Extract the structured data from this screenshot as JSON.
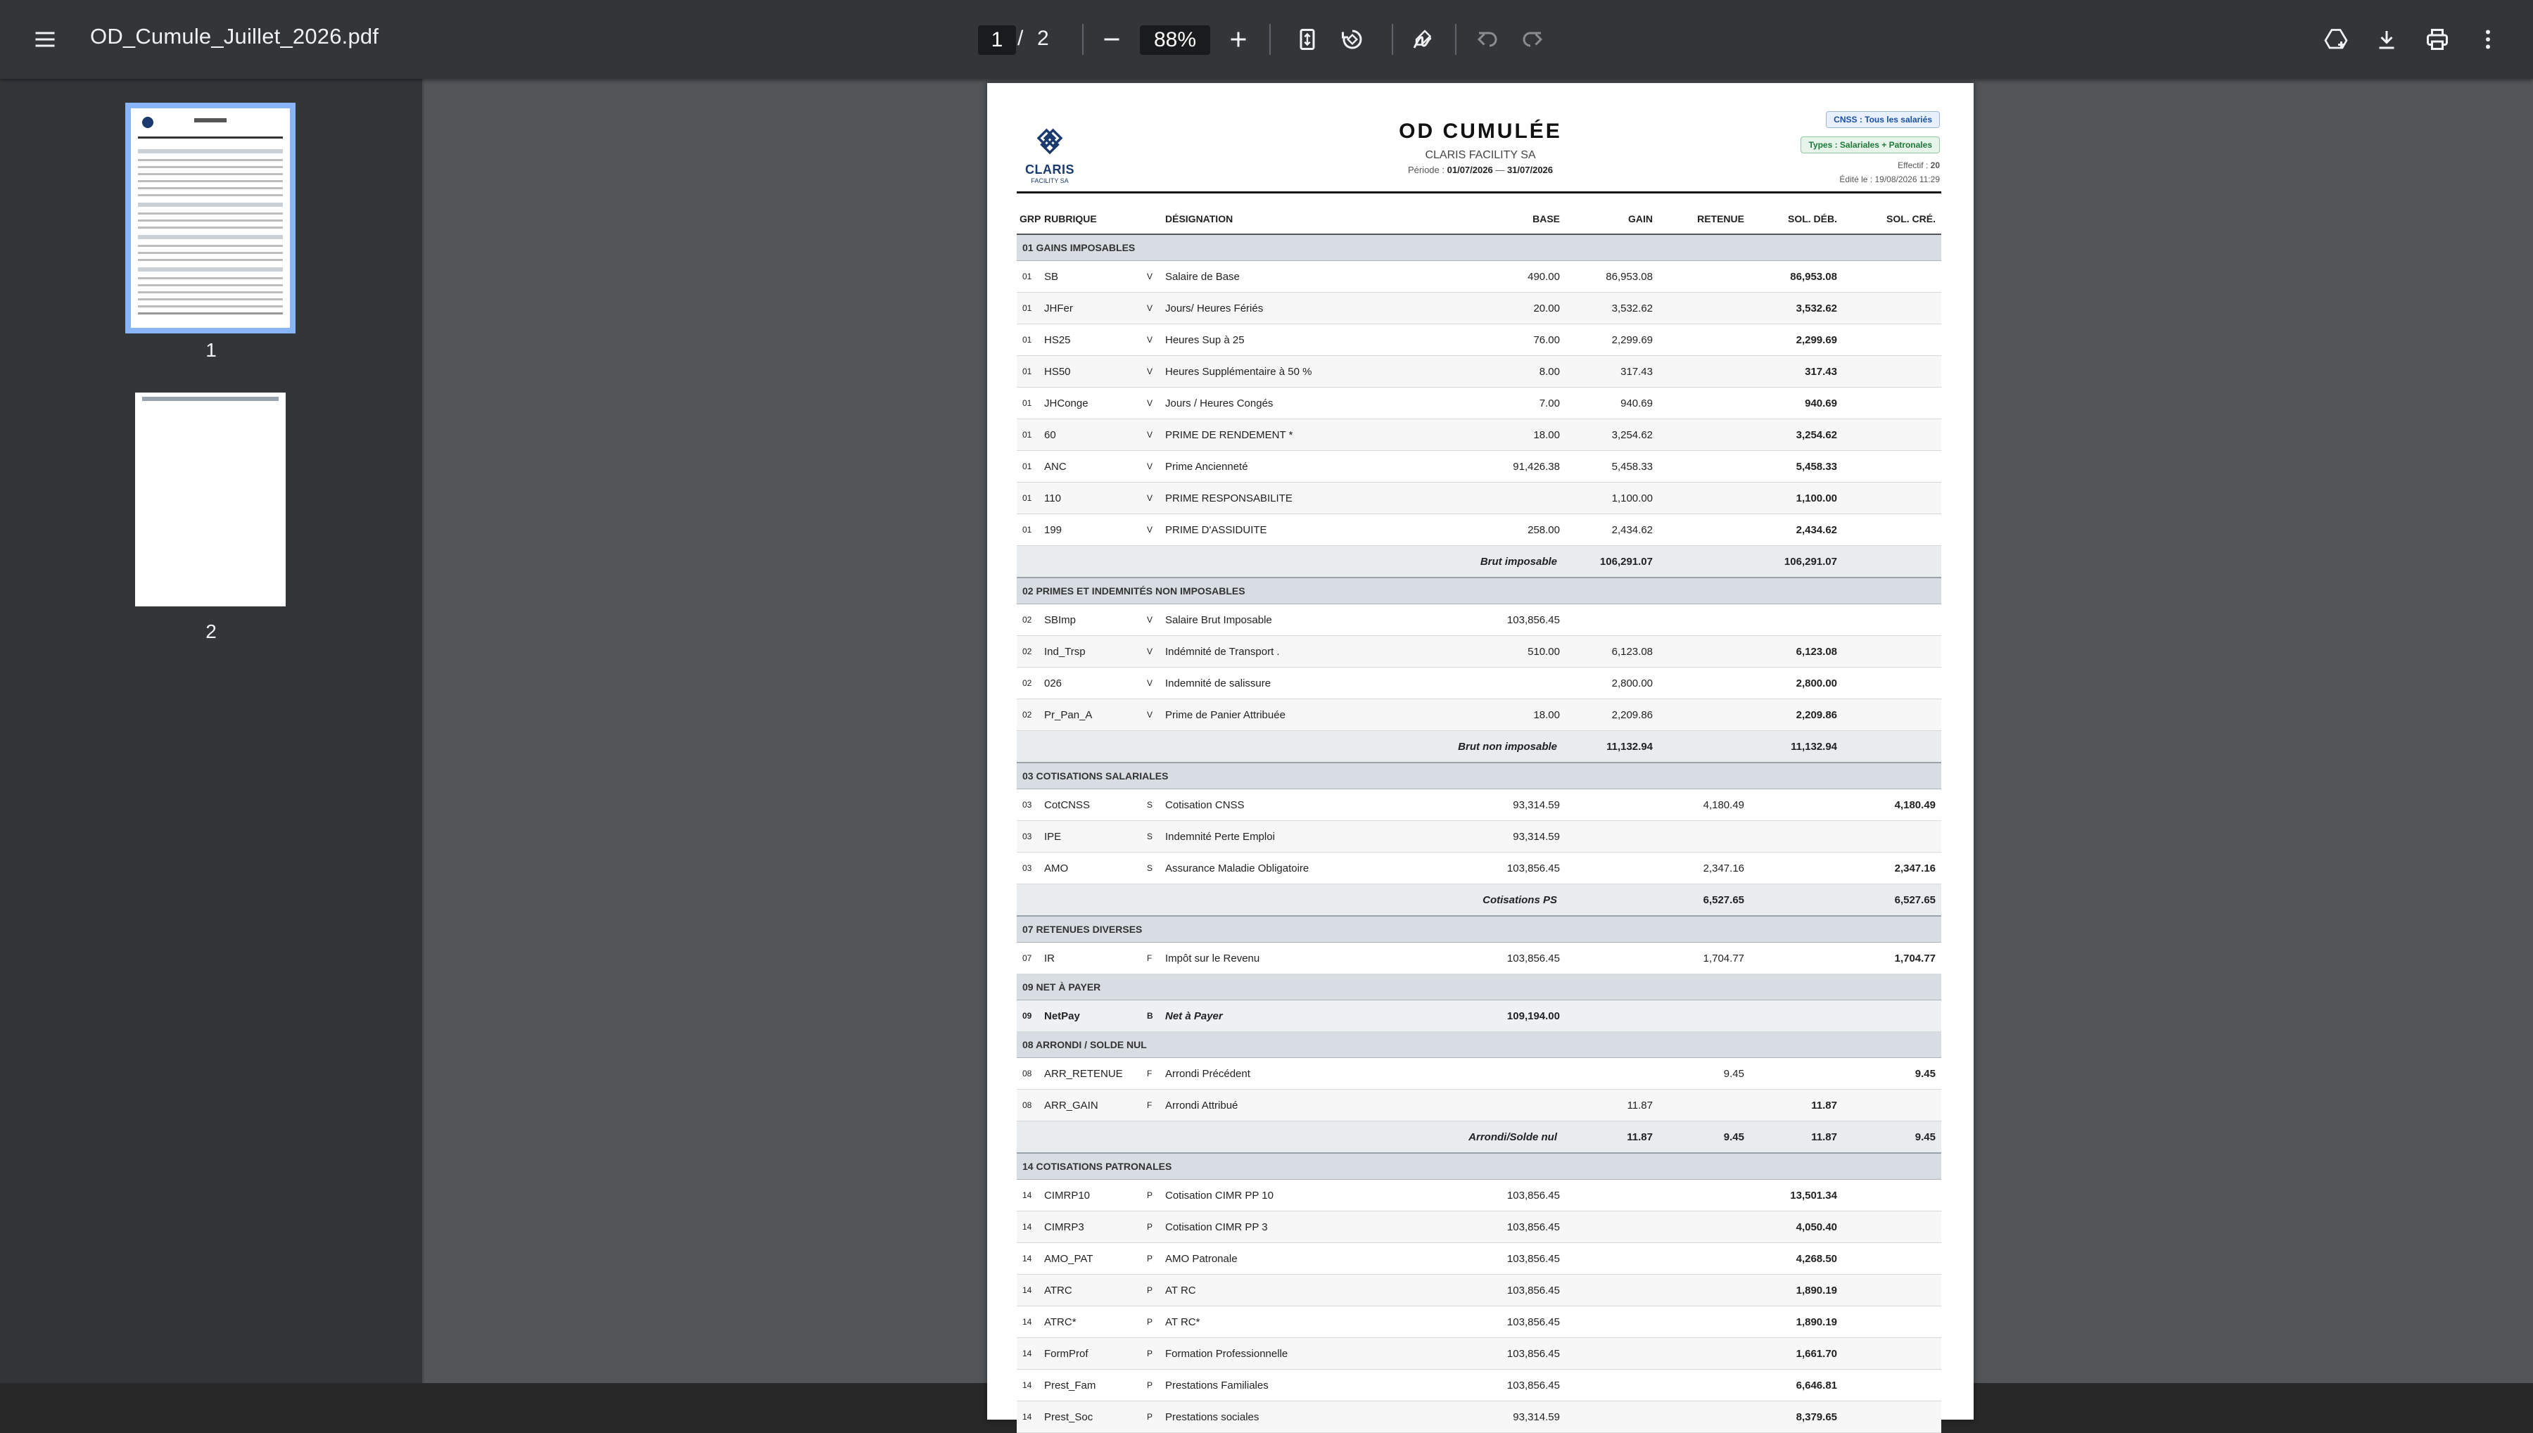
{
  "toolbar": {
    "title": "OD_Cumule_Juillet_2026.pdf",
    "current_page": "1",
    "separator": "/",
    "total_pages": "2",
    "zoom": "88%"
  },
  "sidebar": {
    "thumbnails": [
      {
        "label": "1",
        "selected": true
      },
      {
        "label": "2",
        "selected": false
      }
    ]
  },
  "document": {
    "logo_name": "CLARIS",
    "logo_sub": "FACILITY SA",
    "title": "OD CUMULÉE",
    "company": "CLARIS FACILITY SA",
    "period_label": "Période :",
    "period_start": "01/07/2026",
    "period_dash": "—",
    "period_end": "31/07/2026",
    "badge_cnss": "CNSS : Tous les salariés",
    "badge_types": "Types : Salariales + Patronales",
    "effectif_label": "Effectif :",
    "effectif_value": "20",
    "edited_label": "Édité le :",
    "edited_value": "19/08/2026 11:29",
    "headers": {
      "grp": "GRP",
      "rubrique": "RUBRIQUE",
      "designation": "DÉSIGNATION",
      "base": "BASE",
      "gain": "GAIN",
      "retenue": "RETENUE",
      "sol_deb": "SOL. DÉB.",
      "sol_cre": "SOL. CRÉ."
    },
    "sections": [
      {
        "title": "01  GAINS IMPOSABLES",
        "rows": [
          {
            "grp": "01",
            "code": "SB",
            "type": "V",
            "des": "Salaire de Base",
            "base": "490.00",
            "gain": "86,953.08",
            "ret": "",
            "deb": "86,953.08",
            "cre": ""
          },
          {
            "grp": "01",
            "code": "JHFer",
            "type": "V",
            "des": "Jours/ Heures Fériés",
            "base": "20.00",
            "gain": "3,532.62",
            "ret": "",
            "deb": "3,532.62",
            "cre": ""
          },
          {
            "grp": "01",
            "code": "HS25",
            "type": "V",
            "des": "Heures Sup à 25",
            "base": "76.00",
            "gain": "2,299.69",
            "ret": "",
            "deb": "2,299.69",
            "cre": ""
          },
          {
            "grp": "01",
            "code": "HS50",
            "type": "V",
            "des": "Heures Supplémentaire à 50 %",
            "base": "8.00",
            "gain": "317.43",
            "ret": "",
            "deb": "317.43",
            "cre": ""
          },
          {
            "grp": "01",
            "code": "JHConge",
            "type": "V",
            "des": "Jours / Heures Congés",
            "base": "7.00",
            "gain": "940.69",
            "ret": "",
            "deb": "940.69",
            "cre": ""
          },
          {
            "grp": "01",
            "code": "60",
            "type": "V",
            "des": "PRIME DE RENDEMENT *",
            "base": "18.00",
            "gain": "3,254.62",
            "ret": "",
            "deb": "3,254.62",
            "cre": ""
          },
          {
            "grp": "01",
            "code": "ANC",
            "type": "V",
            "des": "Prime Ancienneté",
            "base": "91,426.38",
            "gain": "5,458.33",
            "ret": "",
            "deb": "5,458.33",
            "cre": ""
          },
          {
            "grp": "01",
            "code": "110",
            "type": "V",
            "des": "PRIME RESPONSABILITE",
            "base": "",
            "gain": "1,100.00",
            "ret": "",
            "deb": "1,100.00",
            "cre": ""
          },
          {
            "grp": "01",
            "code": "199",
            "type": "V",
            "des": "PRIME D'ASSIDUITE",
            "base": "258.00",
            "gain": "2,434.62",
            "ret": "",
            "deb": "2,434.62",
            "cre": ""
          }
        ],
        "subtotal": {
          "label": "Brut imposable",
          "gain": "106,291.07",
          "ret": "",
          "deb": "106,291.07",
          "cre": ""
        }
      },
      {
        "title": "02  PRIMES ET INDEMNITÉS NON IMPOSABLES",
        "rows": [
          {
            "grp": "02",
            "code": "SBImp",
            "type": "V",
            "des": "Salaire Brut Imposable",
            "base": "103,856.45",
            "gain": "",
            "ret": "",
            "deb": "",
            "cre": ""
          },
          {
            "grp": "02",
            "code": "Ind_Trsp",
            "type": "V",
            "des": "Indémnité de Transport .",
            "base": "510.00",
            "gain": "6,123.08",
            "ret": "",
            "deb": "6,123.08",
            "cre": ""
          },
          {
            "grp": "02",
            "code": "026",
            "type": "V",
            "des": "Indemnité de salissure",
            "base": "",
            "gain": "2,800.00",
            "ret": "",
            "deb": "2,800.00",
            "cre": ""
          },
          {
            "grp": "02",
            "code": "Pr_Pan_A",
            "type": "V",
            "des": "Prime de Panier Attribuée",
            "base": "18.00",
            "gain": "2,209.86",
            "ret": "",
            "deb": "2,209.86",
            "cre": ""
          }
        ],
        "subtotal": {
          "label": "Brut non imposable",
          "gain": "11,132.94",
          "ret": "",
          "deb": "11,132.94",
          "cre": ""
        }
      },
      {
        "title": "03  COTISATIONS SALARIALES",
        "rows": [
          {
            "grp": "03",
            "code": "CotCNSS",
            "type": "S",
            "des": "Cotisation CNSS",
            "base": "93,314.59",
            "gain": "",
            "ret": "4,180.49",
            "deb": "",
            "cre": "4,180.49"
          },
          {
            "grp": "03",
            "code": "IPE",
            "type": "S",
            "des": "Indemnité Perte Emploi",
            "base": "93,314.59",
            "gain": "",
            "ret": "",
            "deb": "",
            "cre": ""
          },
          {
            "grp": "03",
            "code": "AMO",
            "type": "S",
            "des": "Assurance Maladie Obligatoire",
            "base": "103,856.45",
            "gain": "",
            "ret": "2,347.16",
            "deb": "",
            "cre": "2,347.16"
          }
        ],
        "subtotal": {
          "label": "Cotisations PS",
          "gain": "",
          "ret": "6,527.65",
          "deb": "",
          "cre": "6,527.65"
        }
      },
      {
        "title": "07  RETENUES DIVERSES",
        "rows": [
          {
            "grp": "07",
            "code": "IR",
            "type": "F",
            "des": "Impôt sur le Revenu",
            "base": "103,856.45",
            "gain": "",
            "ret": "1,704.77",
            "deb": "",
            "cre": "1,704.77"
          }
        ]
      },
      {
        "title": "09  NET À PAYER",
        "net": true,
        "rows": [
          {
            "grp": "09",
            "code": "NetPay",
            "type": "B",
            "des": "Net à Payer",
            "base": "109,194.00",
            "gain": "",
            "ret": "",
            "deb": "",
            "cre": ""
          }
        ]
      },
      {
        "title": "08  ARRONDI / SOLDE NUL",
        "rows": [
          {
            "grp": "08",
            "code": "ARR_RETENUE",
            "type": "F",
            "des": "Arrondi Précédent",
            "base": "",
            "gain": "",
            "ret": "9.45",
            "deb": "",
            "cre": "9.45"
          },
          {
            "grp": "08",
            "code": "ARR_GAIN",
            "type": "F",
            "des": "Arrondi Attribué",
            "base": "",
            "gain": "11.87",
            "ret": "",
            "deb": "11.87",
            "cre": ""
          }
        ],
        "subtotal": {
          "label": "Arrondi/Solde nul",
          "gain": "11.87",
          "ret": "9.45",
          "deb": "11.87",
          "cre": "9.45"
        }
      },
      {
        "title": "14  COTISATIONS PATRONALES",
        "rows": [
          {
            "grp": "14",
            "code": "CIMRP10",
            "type": "P",
            "des": "Cotisation CIMR PP 10",
            "base": "103,856.45",
            "gain": "",
            "ret": "",
            "deb": "13,501.34",
            "cre": ""
          },
          {
            "grp": "14",
            "code": "CIMRP3",
            "type": "P",
            "des": "Cotisation CIMR PP 3",
            "base": "103,856.45",
            "gain": "",
            "ret": "",
            "deb": "4,050.40",
            "cre": ""
          },
          {
            "grp": "14",
            "code": "AMO_PAT",
            "type": "P",
            "des": "AMO Patronale",
            "base": "103,856.45",
            "gain": "",
            "ret": "",
            "deb": "4,268.50",
            "cre": ""
          },
          {
            "grp": "14",
            "code": "ATRC",
            "type": "P",
            "des": "AT RC",
            "base": "103,856.45",
            "gain": "",
            "ret": "",
            "deb": "1,890.19",
            "cre": ""
          },
          {
            "grp": "14",
            "code": "ATRC*",
            "type": "P",
            "des": "AT RC*",
            "base": "103,856.45",
            "gain": "",
            "ret": "",
            "deb": "1,890.19",
            "cre": ""
          },
          {
            "grp": "14",
            "code": "FormProf",
            "type": "P",
            "des": "Formation Professionnelle",
            "base": "103,856.45",
            "gain": "",
            "ret": "",
            "deb": "1,661.70",
            "cre": ""
          },
          {
            "grp": "14",
            "code": "Prest_Fam",
            "type": "P",
            "des": "Prestations Familiales",
            "base": "103,856.45",
            "gain": "",
            "ret": "",
            "deb": "6,646.81",
            "cre": ""
          },
          {
            "grp": "14",
            "code": "Prest_Soc",
            "type": "P",
            "des": "Prestations sociales",
            "base": "93,314.59",
            "gain": "",
            "ret": "",
            "deb": "8,379.65",
            "cre": ""
          }
        ]
      }
    ]
  },
  "icons": {
    "menu": "menu-icon",
    "zoom_out": "minus-icon",
    "zoom_in": "plus-icon",
    "fit": "fit-page-icon",
    "rotate": "rotate-icon",
    "annotate": "pen-icon",
    "undo": "undo-icon",
    "redo": "redo-icon",
    "drive": "drive-add-icon",
    "download": "download-icon",
    "print": "print-icon",
    "more": "more-vert-icon"
  }
}
